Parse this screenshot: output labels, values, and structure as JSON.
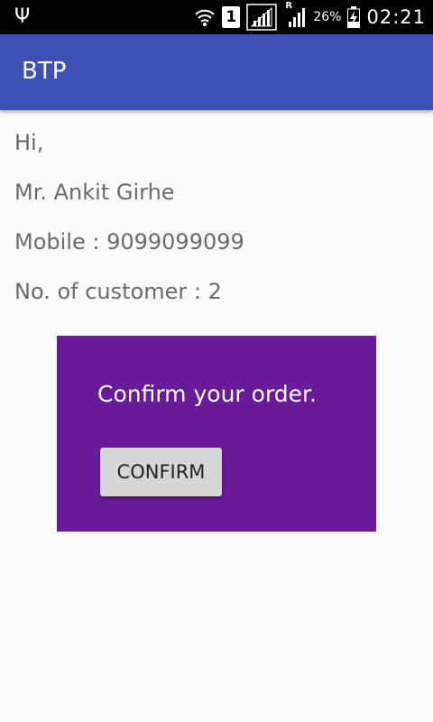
{
  "status_bar": {
    "sim_slot": "1",
    "roaming": "R",
    "battery_percent": "26%",
    "time": "02:21",
    "icons": [
      "usb-icon",
      "wifi-icon",
      "sim-icon",
      "signal-icon",
      "signal-roaming-icon",
      "battery-charging-icon"
    ]
  },
  "app_bar": {
    "title": "BTP",
    "color": "#3f51b5"
  },
  "info": {
    "greeting": "Hi,",
    "name": "Mr. Ankit Girhe",
    "mobile": "Mobile : 9099099099",
    "customers": "No. of customer : 2"
  },
  "confirm_panel": {
    "message": "Confirm your order.",
    "button_label": "CONFIRM",
    "color": "#6a1b9a"
  }
}
